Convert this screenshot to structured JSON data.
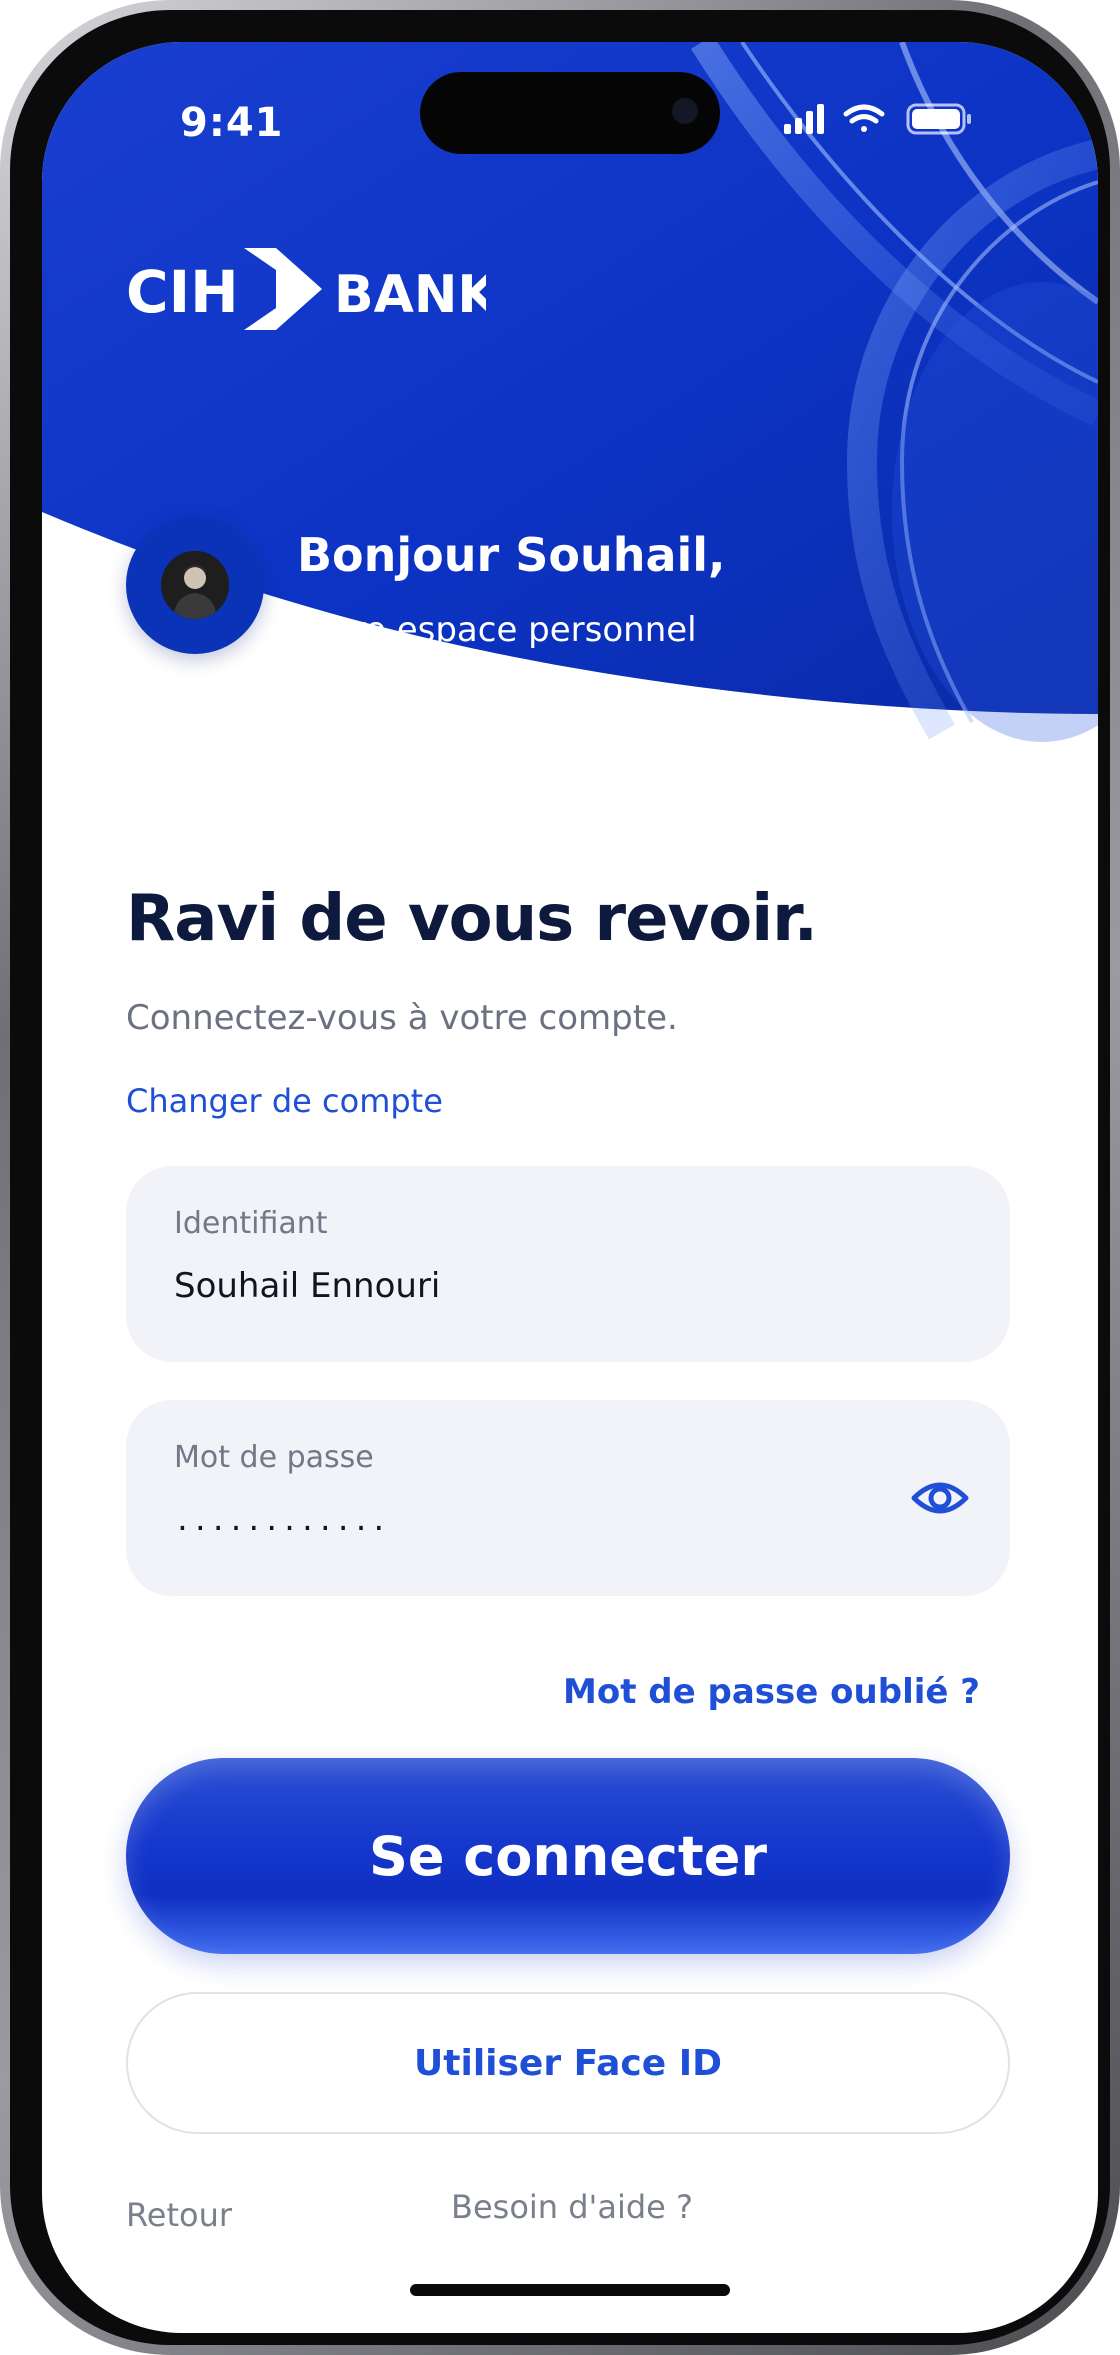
{
  "status_bar": {
    "time": "9:41",
    "icons": [
      "cellular-signal-icon",
      "wifi-icon",
      "battery-icon"
    ]
  },
  "brand": {
    "logo_left": "CIH",
    "logo_right": "BANK",
    "primary_color": "#0b33b7",
    "accent_color": "#1f4fd6"
  },
  "profile": {
    "greeting": "Bonjour Souhail,",
    "subtitle": "Votre espace personnel"
  },
  "login": {
    "title": "Ravi de vous revoir.",
    "subtitle": "Connectez-vous à votre compte.",
    "switch_account": "Changer de compte"
  },
  "fields": {
    "identifier": {
      "label": "Identifiant",
      "value": "Souhail Ennouri"
    },
    "password": {
      "label": "Mot de passe",
      "value": "............",
      "toggle_icon": "eye-icon"
    }
  },
  "links": {
    "forgot_password": "Mot de passe oublié ?",
    "back": "Retour",
    "help": "Besoin d'aide ?"
  },
  "buttons": {
    "connect": "Se connecter",
    "face_id": "Utiliser Face ID"
  }
}
